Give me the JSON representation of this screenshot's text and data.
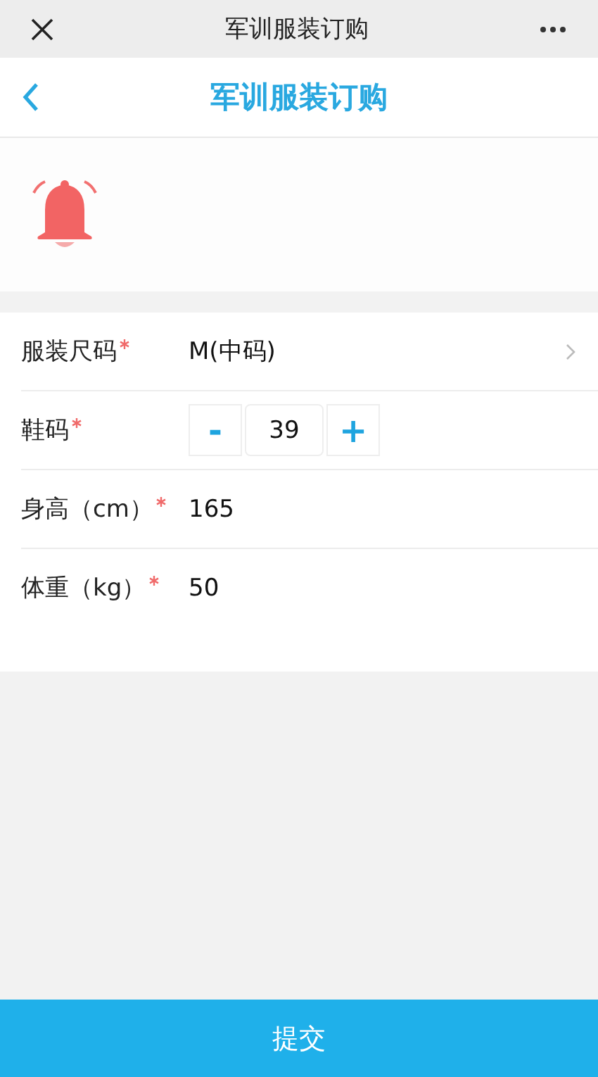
{
  "top_bar": {
    "title": "军训服装订购"
  },
  "nav": {
    "title": "军训服装订购"
  },
  "form": [
    {
      "kind": "select",
      "label": "服装尺码",
      "required": true,
      "value": "M(中码)"
    },
    {
      "kind": "stepper",
      "label": "鞋码",
      "required": true,
      "minus": "-",
      "value": "39",
      "plus": "+"
    },
    {
      "kind": "text",
      "label": "身高（cm）",
      "required": true,
      "value": "165"
    },
    {
      "kind": "text",
      "label": "体重（kg）",
      "required": true,
      "value": "50"
    }
  ],
  "submit": "提交"
}
